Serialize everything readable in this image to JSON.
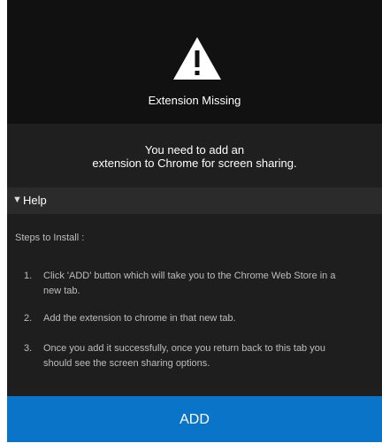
{
  "dialog": {
    "icon": "warning-icon",
    "title": "Extension Missing",
    "message_line1": "You need to add an",
    "message_line2": "extension to Chrome for screen sharing."
  },
  "help": {
    "arrow_icon": "triangle-down-icon",
    "label": "Help",
    "steps_title": "Steps to Install :",
    "steps": [
      {
        "num": "1.",
        "text": "Click 'ADD' button which will take you to the Chrome Web Store in a new tab."
      },
      {
        "num": "2.",
        "text": "Add the extension to chrome in that new tab."
      },
      {
        "num": "3.",
        "text": "Once you add it successfully, once you return back to this tab you should see the screen sharing options."
      }
    ]
  },
  "add_button": {
    "label": "ADD"
  },
  "colors": {
    "accent": "#0a74c8",
    "background": "#1f1f1f",
    "top_panel": "#111111"
  }
}
